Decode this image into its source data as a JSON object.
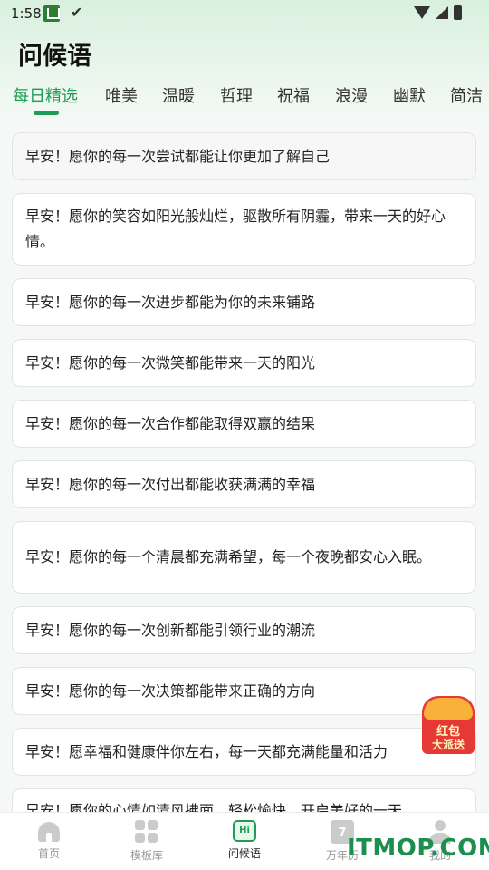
{
  "status_bar": {
    "time": "1:58"
  },
  "header": {
    "title": "问候语"
  },
  "tabs": [
    {
      "label": "每日精选",
      "active": true
    },
    {
      "label": "唯美"
    },
    {
      "label": "温暖"
    },
    {
      "label": "哲理"
    },
    {
      "label": "祝福"
    },
    {
      "label": "浪漫"
    },
    {
      "label": "幽默"
    },
    {
      "label": "简洁"
    }
  ],
  "greetings": [
    "早安！愿你的每一次尝试都能让你更加了解自己",
    "早安！愿你的笑容如阳光般灿烂，驱散所有阴霾，带来一天的好心情。",
    "早安！愿你的每一次进步都能为你的未来铺路",
    "早安！愿你的每一次微笑都能带来一天的阳光",
    "早安！愿你的每一次合作都能取得双赢的结果",
    "早安！愿你的每一次付出都能收获满满的幸福",
    "早安！愿你的每一个清晨都充满希望，每一个夜晚都安心入眠。",
    "早安！愿你的每一次创新都能引领行业的潮流",
    "早安！愿你的每一次决策都能带来正确的方向",
    "早安！愿幸福和健康伴你左右，每一天都充满能量和活力",
    "早安！愿你的心情如清风拂面，轻松愉快，开启美好的一天"
  ],
  "red_packet": {
    "line1": "红包",
    "line2": "大派送"
  },
  "bottom_nav": [
    {
      "label": "首页",
      "icon": "home-icon"
    },
    {
      "label": "模板库",
      "icon": "grid-icon"
    },
    {
      "label": "问候语",
      "icon": "hi-chat-icon",
      "active": true,
      "icon_text": "Hi"
    },
    {
      "label": "万年历",
      "icon": "calendar-icon",
      "icon_text": "7"
    },
    {
      "label": "我的",
      "icon": "person-icon"
    }
  ],
  "watermark": "ITMOP.COM",
  "colors": {
    "accent": "#1f9d55",
    "header_bg": "#d8f0de",
    "red_packet": "#e53935"
  }
}
